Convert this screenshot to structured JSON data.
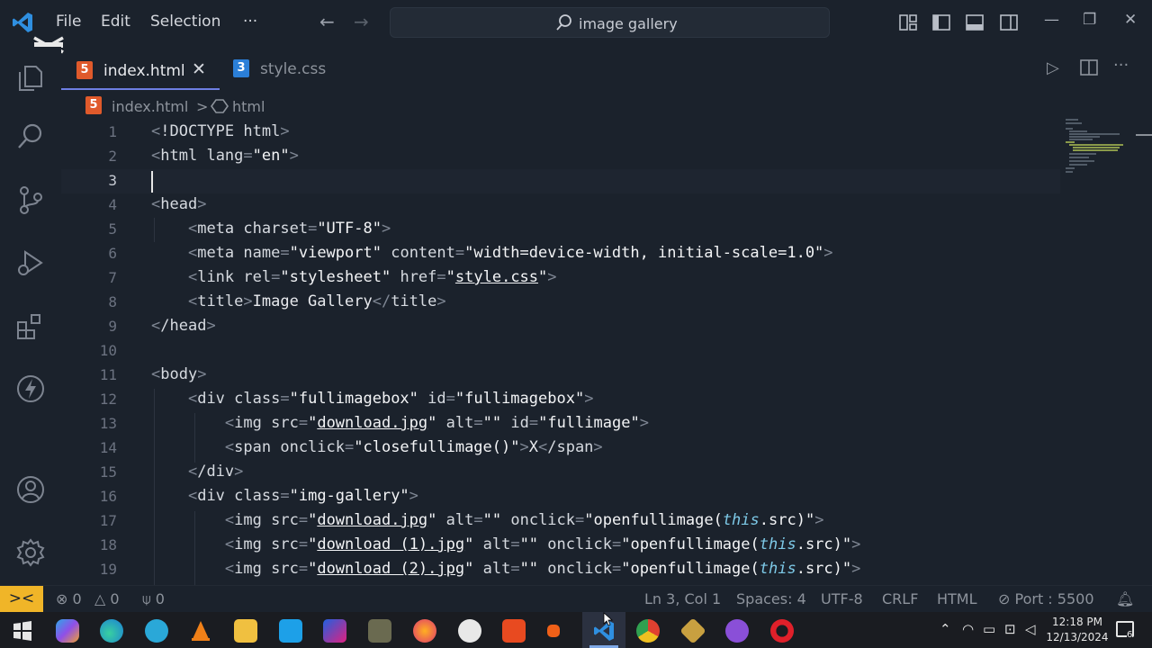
{
  "menu": {
    "file": "File",
    "edit": "Edit",
    "selection": "Selection",
    "more": "···"
  },
  "search": {
    "text": "image gallery"
  },
  "tabs": [
    {
      "label": "index.html",
      "badge": "5",
      "close": "✕"
    },
    {
      "label": "style.css",
      "badge": "3"
    }
  ],
  "breadcrumb": {
    "file": "index.html",
    "separator": ">",
    "symbol": "html"
  },
  "code": {
    "l1": {
      "n": "1",
      "doctype": "!DOCTYPE html"
    },
    "l2": {
      "n": "2",
      "tag": "html",
      "attr": "lang",
      "val": "\"en\""
    },
    "l3": {
      "n": "3"
    },
    "l4": {
      "n": "4",
      "tag": "head"
    },
    "l5": {
      "n": "5",
      "tag": "meta",
      "attr": "charset",
      "val": "\"UTF-8\""
    },
    "l6": {
      "n": "6",
      "tag": "meta",
      "attr1": "name",
      "val1": "\"viewport\"",
      "attr2": "content",
      "val2": "\"width=device-width, initial-scale=1.0\""
    },
    "l7": {
      "n": "7",
      "tag": "link",
      "attr1": "rel",
      "val1": "\"stylesheet\"",
      "attr2": "href",
      "val2_q": "\"",
      "val2": "style.css"
    },
    "l8": {
      "n": "8",
      "tag": "title",
      "text": "Image Gallery"
    },
    "l9": {
      "n": "9",
      "tag": "/head"
    },
    "l10": {
      "n": "10"
    },
    "l11": {
      "n": "11",
      "tag": "body"
    },
    "l12": {
      "n": "12",
      "tag": "div",
      "attr1": "class",
      "val1": "\"fullimagebox\"",
      "attr2": "id",
      "val2": "\"fullimagebox\""
    },
    "l13": {
      "n": "13",
      "tag": "img",
      "attr1": "src",
      "link": "download.jpg",
      "attr2": "alt",
      "val2": "\"\"",
      "attr3": "id",
      "val3": "\"fullimage\""
    },
    "l14": {
      "n": "14",
      "tag": "span",
      "attr": "onclick",
      "val": "\"closefullimage()\"",
      "text": "X",
      "close": "/span"
    },
    "l15": {
      "n": "15",
      "tag": "/div"
    },
    "l16": {
      "n": "16",
      "tag": "div",
      "attr": "class",
      "val": "\"img-gallery\""
    },
    "l17": {
      "n": "17",
      "tag": "img",
      "attr1": "src",
      "link": "download.jpg",
      "attr2": "alt",
      "val2": "\"\"",
      "attr3": "onclick",
      "fn": "openfullimage(",
      "kw": "this",
      "rest": ".src)\""
    },
    "l18": {
      "n": "18",
      "tag": "img",
      "attr1": "src",
      "link": "download (1).jpg",
      "attr2": "alt",
      "val2": "\"\"",
      "attr3": "onclick",
      "fn": "openfullimage(",
      "kw": "this",
      "rest": ".src)\""
    },
    "l19": {
      "n": "19",
      "tag": "img",
      "attr1": "src",
      "link": "download (2).jpg",
      "attr2": "alt",
      "val2": "\"\"",
      "attr3": "onclick",
      "fn": "openfullimage(",
      "kw": "this",
      "rest": ".src)\""
    }
  },
  "status": {
    "remote": "><",
    "errors": "0",
    "warnings": "0",
    "ports": "0",
    "position": "Ln 3, Col 1",
    "spaces": "Spaces: 4",
    "encoding": "UTF-8",
    "eol": "CRLF",
    "language": "HTML",
    "live_server": "Port : 5500"
  },
  "taskbar": {
    "time": "12:18 PM",
    "date": "12/13/2024",
    "notifications": "6"
  },
  "colors": {
    "accent": "#f0b528",
    "html_badge": "#e05a2b",
    "css_badge": "#2b7fd8",
    "editor_bg": "#1b222c"
  }
}
